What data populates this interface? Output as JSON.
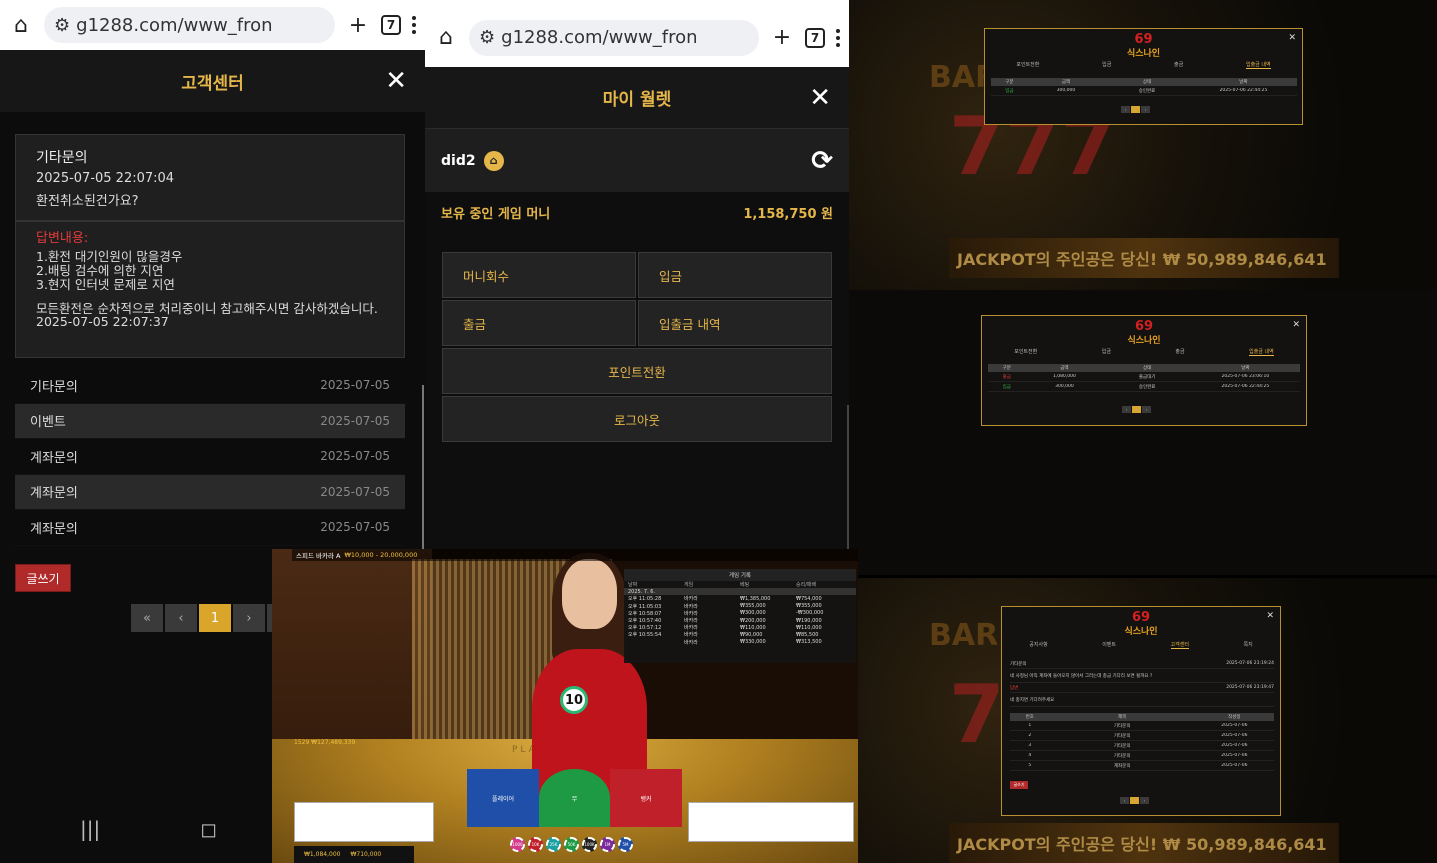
{
  "phone1": {
    "url": "g1288.com/www_fron",
    "tab_count": "7",
    "title": "고객센터",
    "close": "✕",
    "question": {
      "category": "기타문의",
      "datetime": "2025-07-05 22:07:04",
      "text": "환전취소된건가요?"
    },
    "answer": {
      "label": "답변내용:",
      "line1": "1.환전 대기인원이 많을경우",
      "line2": "2.배팅 검수에 의한 지연",
      "line3": "3.현지 인터넷 문제로 지연",
      "para": "모든환전은 순차적으로 처리중이니 참고해주시면 감사하겠습니다.",
      "datetime": "2025-07-05 22:07:37"
    },
    "list": [
      {
        "title": "기타문의",
        "date": "2025-07-05"
      },
      {
        "title": "이벤트",
        "date": "2025-07-05"
      },
      {
        "title": "계좌문의",
        "date": "2025-07-05"
      },
      {
        "title": "계좌문의",
        "date": "2025-07-05"
      },
      {
        "title": "계좌문의",
        "date": "2025-07-05"
      }
    ],
    "write_button": "글쓰기",
    "pager": {
      "first": "«",
      "prev": "‹",
      "current": "1",
      "next": "›",
      "last": "»"
    }
  },
  "phone2": {
    "url": "g1288.com/www_fron",
    "tab_count": "7",
    "title": "마이 월렛",
    "close": "✕",
    "username": "did2",
    "balance_label": "보유 중인 게임 머니",
    "balance_value": "1,158,750 원",
    "buttons": {
      "recover": "머니회수",
      "deposit": "입금",
      "withdraw": "출금",
      "history": "입출금 내역",
      "point": "포인트전환",
      "logout": "로그아웃"
    }
  },
  "shot1": {
    "tabs": [
      "포인트전환",
      "입금",
      "출금",
      "입출금 내역"
    ],
    "headers": [
      "구분",
      "금액",
      "상태",
      "날짜"
    ],
    "rows": [
      {
        "type": "입금",
        "amount": "300,000",
        "status": "승인완료",
        "date": "2025-07-06 22:44:25"
      }
    ],
    "jackpot": "JACKPOT의 주인공은 당신! ₩ 50,989,846,641"
  },
  "shot2": {
    "tabs": [
      "포인트전환",
      "입금",
      "출금",
      "입출금 내역"
    ],
    "headers": [
      "구분",
      "금액",
      "상태",
      "날짜"
    ],
    "rows": [
      {
        "type": "출금",
        "amount": "1,080,000",
        "status": "출금대기",
        "date": "2025-07-06 23:06:10"
      },
      {
        "type": "입금",
        "amount": "300,000",
        "status": "승인완료",
        "date": "2025-07-06 22:44:25"
      }
    ]
  },
  "shot3": {
    "tabs": [
      "공지사항",
      "이벤트",
      "고객센터",
      "쪽지"
    ],
    "q_title": "기타문의",
    "q_date": "2025-07-06 23:19:24",
    "q_text": "네 사정님 아직 계좌에 들어오지 않아서 그러는데 충금 기다리 보면 될까요 ?",
    "a_label": "답변",
    "a_date": "2025-07-06 23:19:47",
    "a_text": "네 충지면 기다려주세요",
    "headers": [
      "번호",
      "제목",
      "작성일"
    ],
    "rows": [
      {
        "no": "1",
        "title": "기타문의",
        "date": "2025-07-06"
      },
      {
        "no": "2",
        "title": "기타문의",
        "date": "2025-07-06"
      },
      {
        "no": "3",
        "title": "기타문의",
        "date": "2025-07-06"
      },
      {
        "no": "4",
        "title": "기타문의",
        "date": "2025-07-06"
      },
      {
        "no": "5",
        "title": "계좌문의",
        "date": "2025-07-06"
      }
    ],
    "write_button": "글쓰기",
    "jackpot": "JACKPOT의 주인공은 당신! ₩ 50,989,846,641"
  },
  "game": {
    "title": "스피드 바카라 A",
    "limits": "₩10,000 - 20,000,000",
    "history_title": "게임 기록",
    "history_headers": [
      "날짜",
      "게임",
      "베팅",
      "승리/패배"
    ],
    "history_date": "2025. 7. 6.",
    "history_rows": [
      {
        "time": "오후 11:05:28",
        "game": "바카라",
        "bet": "₩1,385,000",
        "result": "₩754,000"
      },
      {
        "time": "오후 11:05:03",
        "game": "바카라",
        "bet": "₩355,000",
        "result": "₩355,000"
      },
      {
        "time": "오후 10:58:07",
        "game": "바카라",
        "bet": "₩300,000",
        "result": "-₩300,000"
      },
      {
        "time": "오후 10:57:40",
        "game": "바카라",
        "bet": "₩200,000",
        "result": "₩190,000"
      },
      {
        "time": "오후 10:57:12",
        "game": "바카라",
        "bet": "₩110,000",
        "result": "₩110,000"
      },
      {
        "time": "오후 10:55:54",
        "game": "바카라",
        "bet": "₩90,000",
        "result": "₩85,500"
      },
      {
        "time": "",
        "game": "바카라",
        "bet": "₩330,000",
        "result": "₩313,500"
      }
    ],
    "timer": "10",
    "player_text": "PLAYER",
    "player_label": "플레이어",
    "banker_label": "뱅커",
    "tie_label": "무",
    "left_info": "1529 ₩127,489,339",
    "balance": "₩1,084,000",
    "total_bet": "₩710,000",
    "chips": [
      "1000",
      "10K",
      "25K",
      "50K",
      "100K",
      "1M",
      "5M"
    ]
  }
}
